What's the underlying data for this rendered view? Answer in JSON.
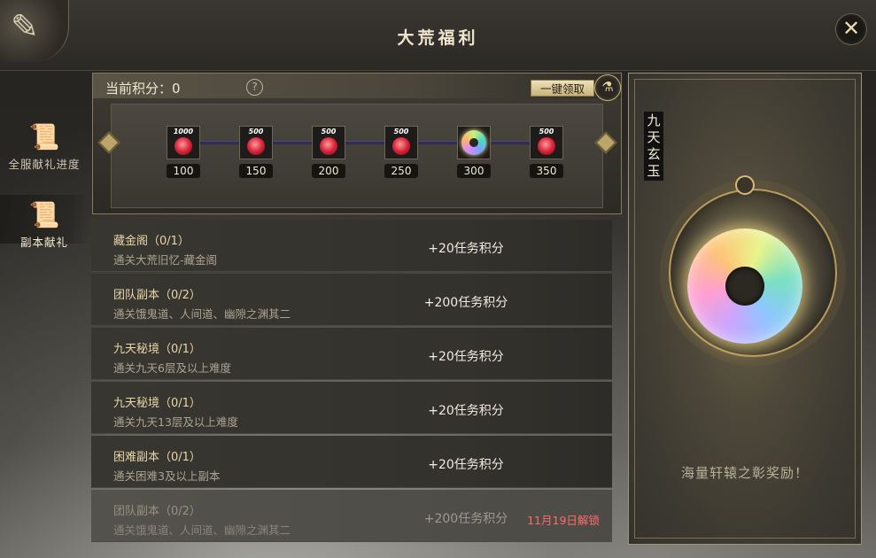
{
  "window": {
    "title": "大荒福利"
  },
  "side_nav": [
    {
      "label": "全服献礼进度",
      "icon": "scroll-icon",
      "active": false
    },
    {
      "label": "副本献礼",
      "icon": "scroll-icon",
      "active": true
    }
  ],
  "score": {
    "label": "当前积分：0",
    "claim_all_label": "一键领取"
  },
  "milestones": [
    {
      "threshold": "100",
      "reward_amount": "1000",
      "reward_type": "red-gem"
    },
    {
      "threshold": "150",
      "reward_amount": "500",
      "reward_type": "red-gem"
    },
    {
      "threshold": "200",
      "reward_amount": "500",
      "reward_type": "red-gem"
    },
    {
      "threshold": "250",
      "reward_amount": "500",
      "reward_type": "red-gem"
    },
    {
      "threshold": "300",
      "reward_amount": "",
      "reward_type": "jade"
    },
    {
      "threshold": "350",
      "reward_amount": "500",
      "reward_type": "red-gem"
    }
  ],
  "tasks": [
    {
      "title": "藏金阁（0/1）",
      "desc": "通关大荒旧忆-藏金阁",
      "points": "+20任务积分",
      "unlock": "",
      "locked": false
    },
    {
      "title": "团队副本（0/2）",
      "desc": "通关饿鬼道、人间道、幽隙之渊其二",
      "points": "+200任务积分",
      "unlock": "",
      "locked": false
    },
    {
      "title": "九天秘境（0/1）",
      "desc": "通关九天6层及以上难度",
      "points": "+20任务积分",
      "unlock": "",
      "locked": false
    },
    {
      "title": "九天秘境（0/1）",
      "desc": "通关九天13层及以上难度",
      "points": "+20任务积分",
      "unlock": "",
      "locked": false
    },
    {
      "title": "困难副本（0/1）",
      "desc": "通关困难3及以上副本",
      "points": "+20任务积分",
      "unlock": "",
      "locked": false
    },
    {
      "title": "团队副本（0/2）",
      "desc": "通关饿鬼道、人间道、幽隙之渊其二",
      "points": "+200任务积分",
      "unlock": "11月19日解锁",
      "locked": true
    }
  ],
  "reward": {
    "name": "九天玄玉",
    "caption": "海量轩辕之彰奖励！"
  },
  "colors": {
    "accent_gold": "#c9b37b",
    "unlock_red": "#ff6b6b",
    "track_line": "#2f2d54"
  }
}
